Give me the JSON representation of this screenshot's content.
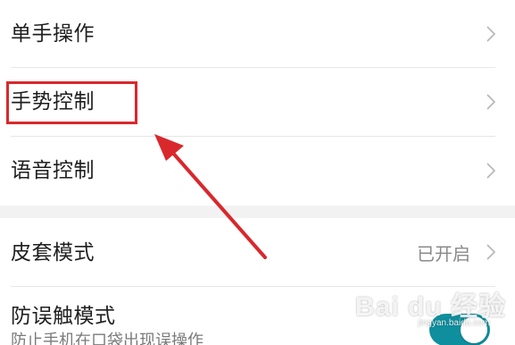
{
  "settings": {
    "items": [
      {
        "label": "单手操作",
        "value": ""
      },
      {
        "label": "手势控制",
        "value": ""
      },
      {
        "label": "语音控制",
        "value": ""
      },
      {
        "label": "皮套模式",
        "value": "已开启"
      },
      {
        "label": "防误触模式",
        "sublabel": "防止手机在口袋出现误操作",
        "toggle_on": true
      }
    ]
  },
  "annotation": {
    "highlight_color": "#d9282c",
    "highlighted_item": "手势控制"
  },
  "watermark": {
    "text": "Bai du 经验",
    "sub": "jingyan.baidu.com"
  },
  "colors": {
    "toggle_on": "#0f8f9e",
    "section_background": "#f2f2f2"
  }
}
